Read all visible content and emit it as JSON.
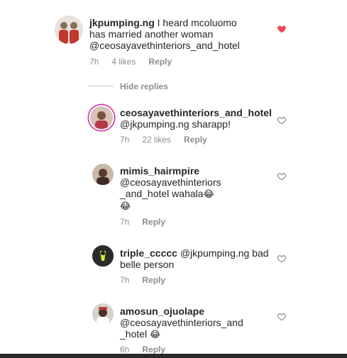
{
  "main_comment": {
    "username": "jkpumping.ng",
    "line1": " I heard mcoluomo",
    "line2": "has married another woman",
    "line3": "@ceosayavethinteriors_and_hotel",
    "time": "7h",
    "likes": "4 likes",
    "reply": "Reply",
    "liked": true
  },
  "hide_replies": "Hide replies",
  "replies": [
    {
      "username": "ceosayavethinteriors_and_hotel",
      "line1": "@jkpumping.ng sharapp!",
      "time": "7h",
      "likes": "22 likes",
      "reply": "Reply"
    },
    {
      "username": "mimis_hairmpire",
      "line1": "@ceosayavethinteriors",
      "line2": "_and_hotel wahala",
      "emoji": "😂",
      "time": "7h",
      "reply": "Reply"
    },
    {
      "username": "triple_ccccc",
      "line1a": " @jkpumping.ng bad",
      "line2": "belle person",
      "time": "7h",
      "reply": "Reply"
    },
    {
      "username": "amosun_ojuolape",
      "line1": "@ceosayavethinteriors_and",
      "line2": "_hotel",
      "emoji": "😂",
      "time": "6h",
      "reply": "Reply"
    }
  ],
  "colors": {
    "liked_heart": "#ed4956",
    "muted": "#8e8e8e"
  }
}
